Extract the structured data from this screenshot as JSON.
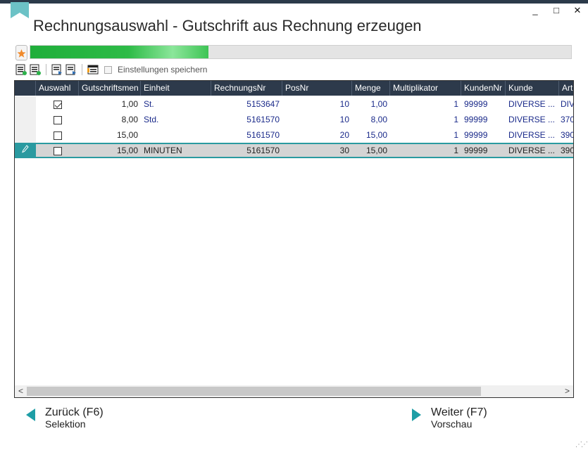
{
  "window": {
    "title": "Rechnungsauswahl - Gutschrift aus Rechnung erzeugen",
    "controls": {
      "minimize": "_",
      "maximize": "□",
      "close": "✕"
    }
  },
  "progress": {
    "value_fraction": 0.33,
    "accent": "#1fae3a"
  },
  "toolbar": {
    "icons": [
      "select-all-icon",
      "deselect-icon",
      "export-icon",
      "import-icon",
      "columns-icon"
    ],
    "save_settings_label": "Einstellungen speichern",
    "save_settings_checked": false
  },
  "grid": {
    "columns": [
      "Auswahl",
      "Gutschriftsmen",
      "Einheit",
      "RechnungsNr",
      "PosNr",
      "Menge",
      "Multiplikator",
      "KundenNr",
      "Kunde",
      "Art"
    ],
    "rows": [
      {
        "checked": true,
        "gutschrift": "1,00",
        "einheit": "St.",
        "rechnung": "5153647",
        "pos": "10",
        "menge": "1,00",
        "multi": "1",
        "kunde_nr": "99999",
        "kunde": "DIVERSE ...",
        "art": "DIV",
        "selected": false
      },
      {
        "checked": false,
        "gutschrift": "8,00",
        "einheit": "Std.",
        "rechnung": "5161570",
        "pos": "10",
        "menge": "8,00",
        "multi": "1",
        "kunde_nr": "99999",
        "kunde": "DIVERSE ...",
        "art": "370",
        "selected": false
      },
      {
        "checked": false,
        "gutschrift": "15,00",
        "einheit": "",
        "rechnung": "5161570",
        "pos": "20",
        "menge": "15,00",
        "multi": "1",
        "kunde_nr": "99999",
        "kunde": "DIVERSE ...",
        "art": "390",
        "selected": false
      },
      {
        "checked": false,
        "gutschrift": "15,00",
        "einheit": "MINUTEN",
        "rechnung": "5161570",
        "pos": "30",
        "menge": "15,00",
        "multi": "1",
        "kunde_nr": "99999",
        "kunde": "DIVERSE ...",
        "art": "390",
        "selected": true
      }
    ],
    "scroll_left": "<",
    "scroll_right": ">"
  },
  "nav": {
    "back_label": "Zurück (F6)",
    "back_sub": "Selektion",
    "next_label": "Weiter (F7)",
    "next_sub": "Vorschau"
  },
  "colors": {
    "header_bg": "#2d3a4b",
    "teal": "#1e9ea6",
    "value_blue": "#1a2a8a"
  }
}
